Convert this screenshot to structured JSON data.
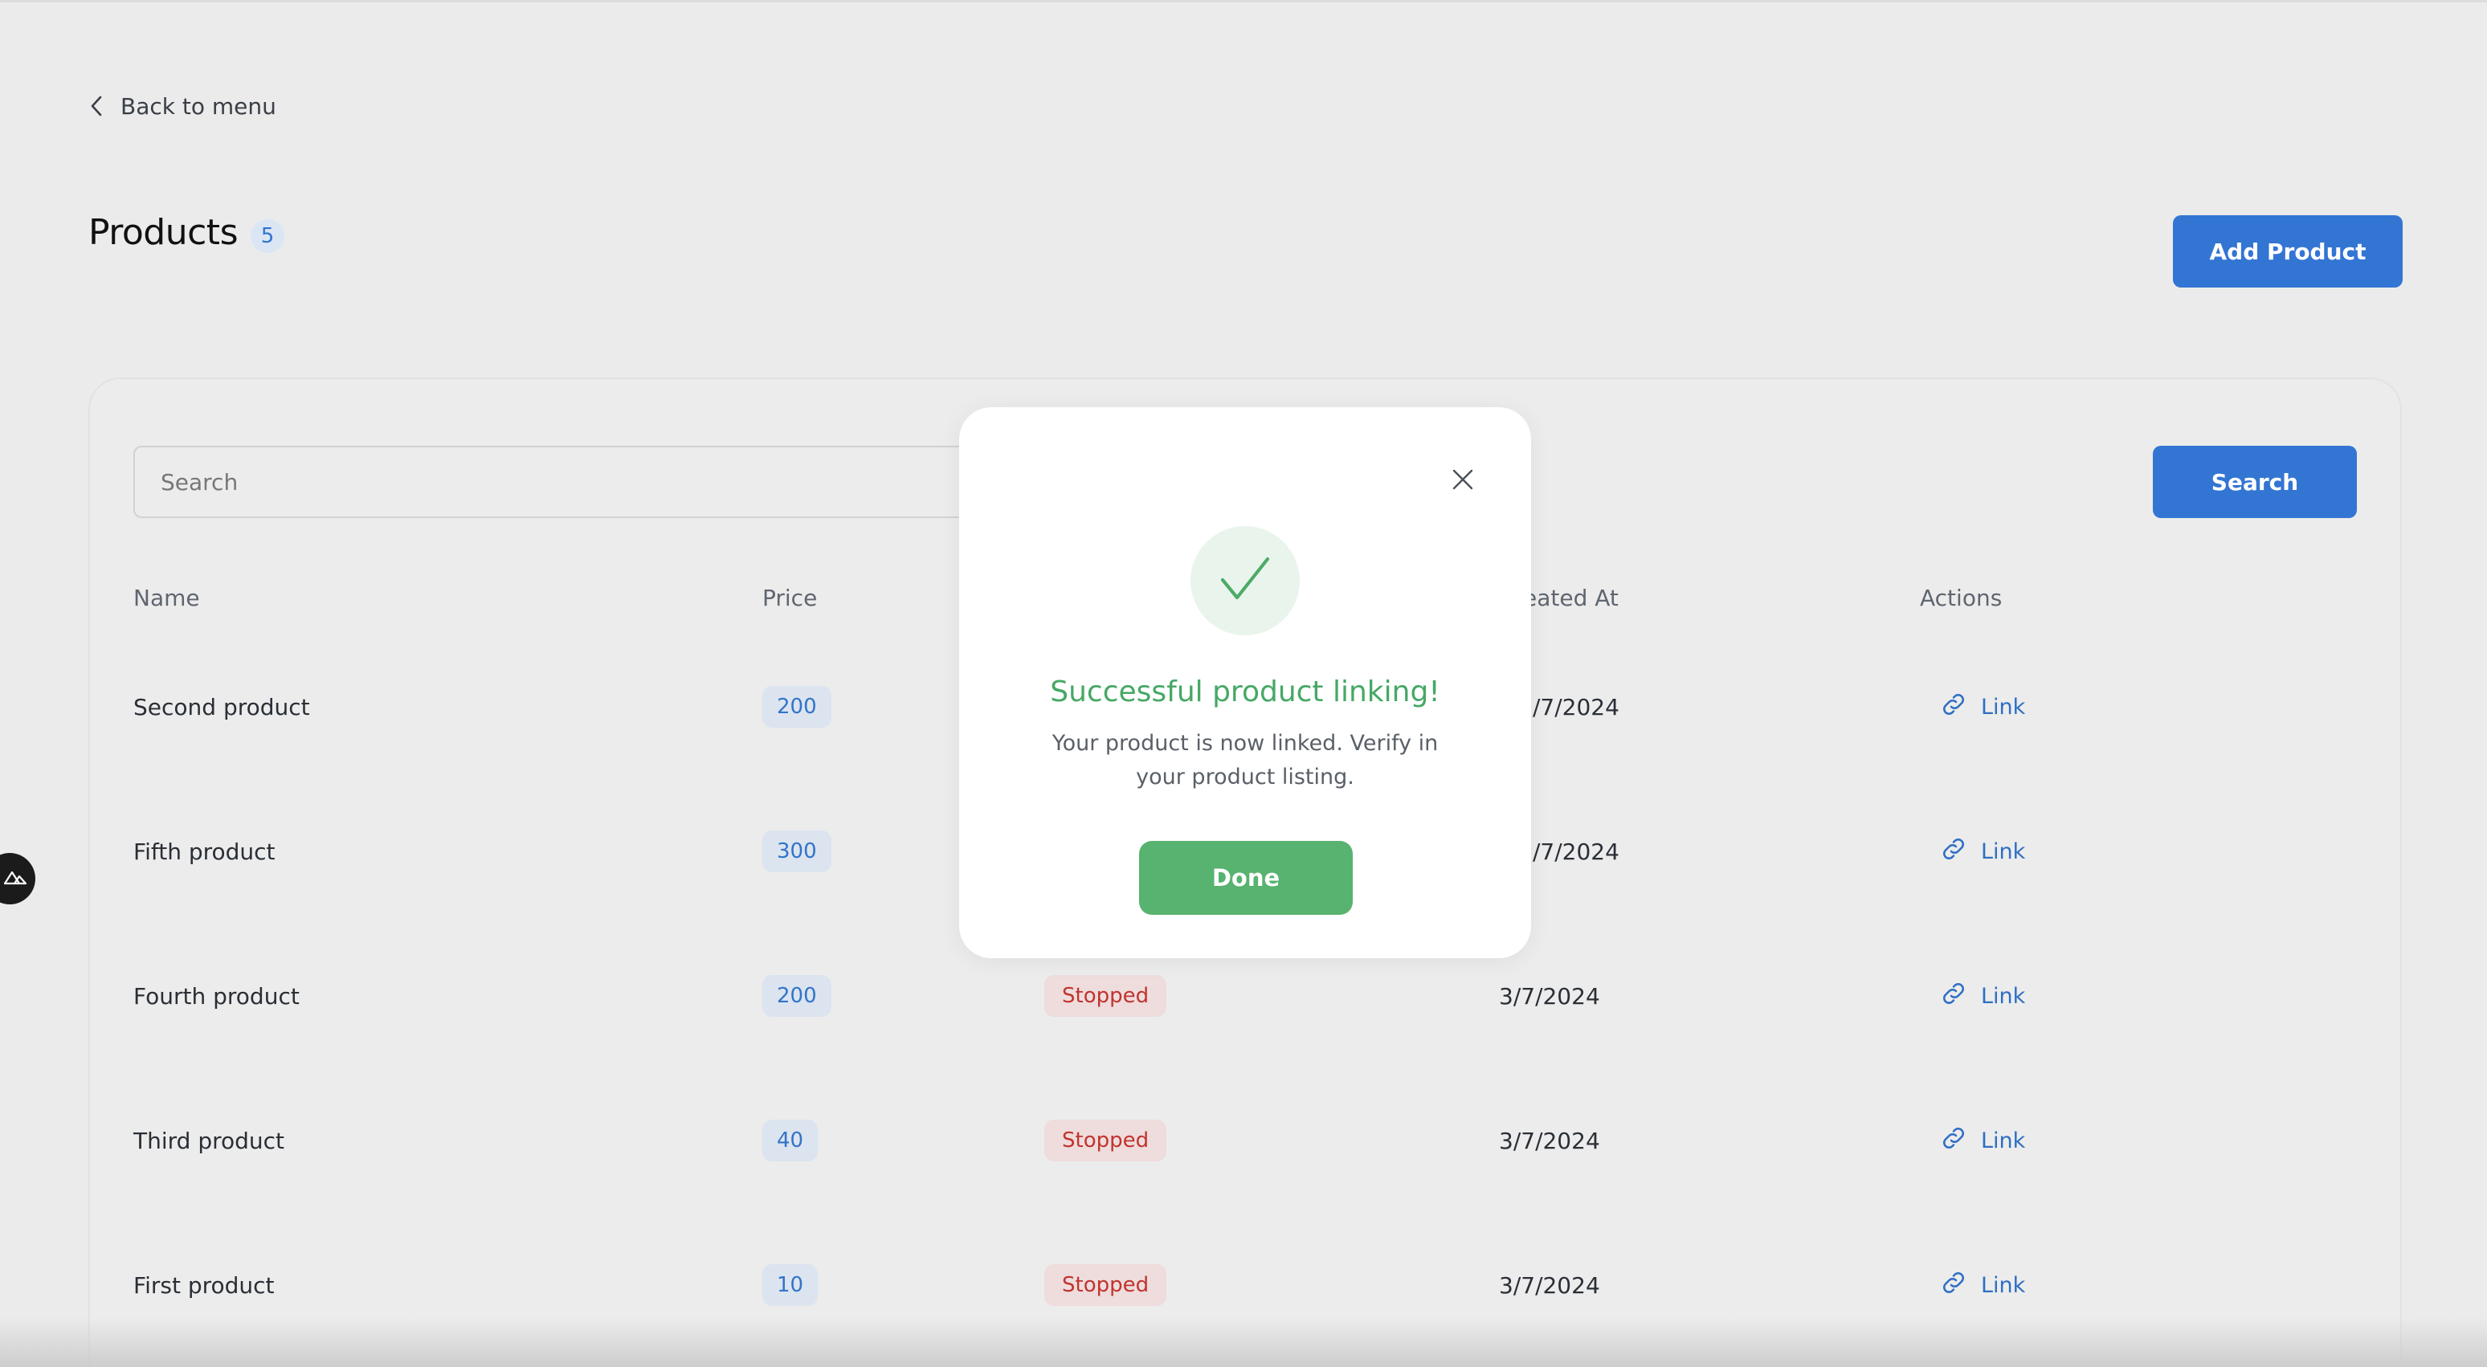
{
  "nav": {
    "back_label": "Back to menu"
  },
  "header": {
    "title": "Products",
    "count": "5",
    "add_button": "Add Product"
  },
  "search": {
    "placeholder": "Search",
    "value": "",
    "button": "Search"
  },
  "table": {
    "columns": {
      "name": "Name",
      "price": "Price",
      "created_at": "eated At",
      "actions": "Actions"
    },
    "rows": [
      {
        "name": "Second product",
        "price": "200",
        "status": "",
        "created": "/7/2024",
        "action": "Link"
      },
      {
        "name": "Fifth product",
        "price": "300",
        "status": "",
        "created": "/7/2024",
        "action": "Link"
      },
      {
        "name": "Fourth product",
        "price": "200",
        "status": "Stopped",
        "created": "3/7/2024",
        "action": "Link"
      },
      {
        "name": "Third product",
        "price": "40",
        "status": "Stopped",
        "created": "3/7/2024",
        "action": "Link"
      },
      {
        "name": "First product",
        "price": "10",
        "status": "Stopped",
        "created": "3/7/2024",
        "action": "Link"
      }
    ]
  },
  "modal": {
    "title": "Successful product linking!",
    "message": "Your product is now linked. Verify in your product listing.",
    "done_button": "Done"
  },
  "colors": {
    "primary": "#3375d3",
    "success": "#57b36f",
    "danger": "#c0342f",
    "background": "#ebebeb"
  },
  "icons": {
    "back": "chevron-left-icon",
    "close": "close-icon",
    "success": "check-icon",
    "link": "link-icon",
    "widget": "mountain-logo-icon"
  }
}
